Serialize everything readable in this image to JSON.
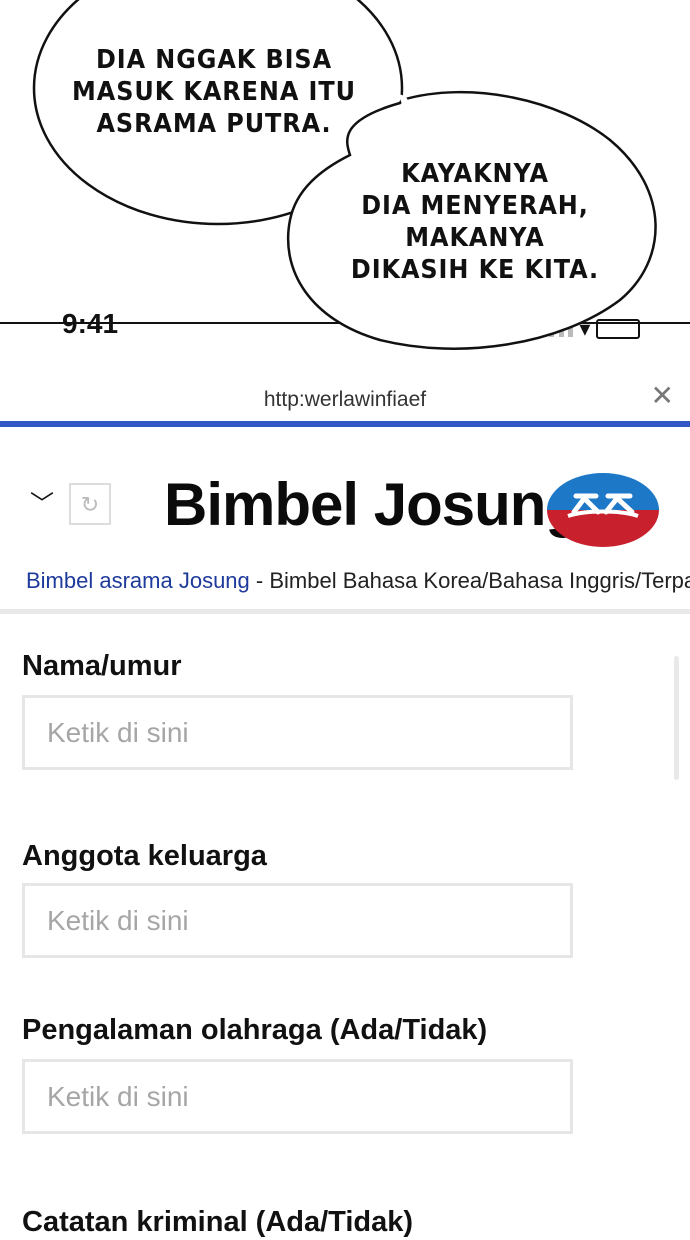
{
  "bubbles": [
    {
      "text": "DIA NGGAK BISA\nMASUK KARENA ITU\nASRAMA PUTRA."
    },
    {
      "text": "KAYAKNYA\nDIA MENYERAH,\nMAKANYA\nDIKASIH KE KITA."
    }
  ],
  "status_bar": {
    "time": "9:41"
  },
  "browser": {
    "url": "http:werlawinfiaef",
    "close_icon": "close-icon"
  },
  "header": {
    "back_icon": "chevron-down-icon",
    "reload_icon": "reload-icon",
    "title": "Bimbel Josung",
    "logo_colors": {
      "top": "#1d78c8",
      "bottom": "#c8202c"
    }
  },
  "subline": {
    "link": "Bimbel asrama Josung",
    "rest": " - Bimbel Bahasa Korea/Bahasa Inggris/Terpadu"
  },
  "form": {
    "fields": [
      {
        "label": "Nama/umur",
        "placeholder": "Ketik di sini",
        "value": ""
      },
      {
        "label": "Anggota keluarga",
        "placeholder": "Ketik di sini",
        "value": ""
      },
      {
        "label": "Pengalaman olahraga (Ada/Tidak)",
        "placeholder": "Ketik di sini",
        "value": ""
      },
      {
        "label": "Catatan kriminal (Ada/Tidak)"
      }
    ]
  }
}
